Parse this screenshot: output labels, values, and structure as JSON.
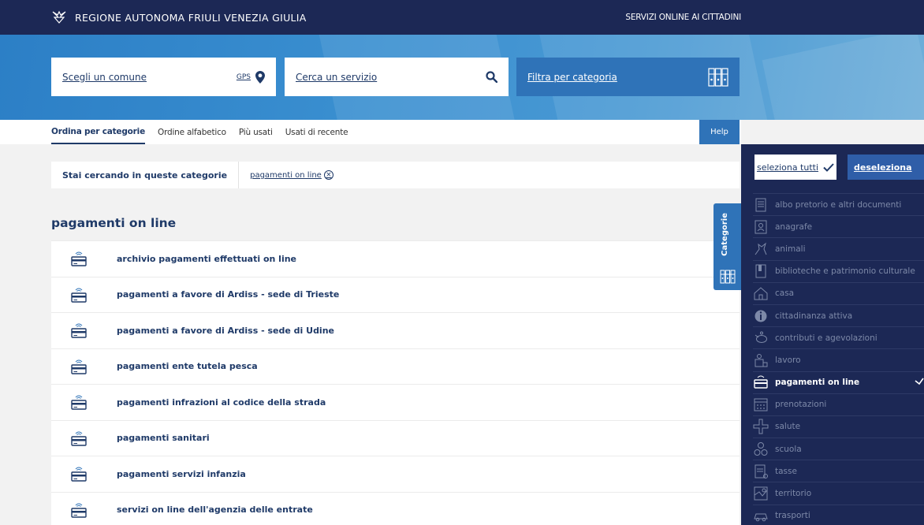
{
  "header": {
    "title": "REGIONE AUTONOMA FRIULI VENEZIA GIULIA",
    "right_link": "SERVIZI ONLINE AI CITTADINI"
  },
  "search": {
    "comune_label": "Scegli un comune",
    "gps_label": "GPS",
    "servizio_label": "Cerca un servizio",
    "filter_label": "Filtra per categoria"
  },
  "tabs": [
    {
      "label": "Ordina per categorie",
      "active": true
    },
    {
      "label": "Ordine alfabetico",
      "active": false
    },
    {
      "label": "Più usati",
      "active": false
    },
    {
      "label": "Usati di recente",
      "active": false
    }
  ],
  "help_label": "Help",
  "filter_bar": {
    "label": "Stai cercando in queste categorie",
    "chip": "pagamenti on line"
  },
  "section_title": "pagamenti on line",
  "services": [
    "archivio pagamenti effettuati on line",
    "pagamenti a favore di Ardiss - sede di Trieste",
    "pagamenti a favore di Ardiss - sede di Udine",
    "pagamenti ente tutela pesca",
    "pagamenti infrazioni al codice della strada",
    "pagamenti sanitari",
    "pagamenti servizi infanzia",
    "servizi on line dell'agenzia delle entrate"
  ],
  "categorie_tab": "Categorie",
  "panel": {
    "select_all": "seleziona tutti",
    "deselect": "deseleziona",
    "categories": [
      {
        "label": "albo pretorio e altri documenti",
        "icon": "document-list-icon",
        "selected": false
      },
      {
        "label": "anagrafe",
        "icon": "id-card-icon",
        "selected": false
      },
      {
        "label": "animali",
        "icon": "animal-icon",
        "selected": false
      },
      {
        "label": "biblioteche e patrimonio culturale",
        "icon": "book-icon",
        "selected": false
      },
      {
        "label": "casa",
        "icon": "house-icon",
        "selected": false
      },
      {
        "label": "cittadinanza attiva",
        "icon": "info-icon",
        "selected": false
      },
      {
        "label": "contributi e agevolazioni",
        "icon": "piggy-bank-icon",
        "selected": false
      },
      {
        "label": "lavoro",
        "icon": "work-icon",
        "selected": false
      },
      {
        "label": "pagamenti on line",
        "icon": "payment-card-icon",
        "selected": true
      },
      {
        "label": "prenotazioni",
        "icon": "calendar-icon",
        "selected": false
      },
      {
        "label": "salute",
        "icon": "cross-icon",
        "selected": false
      },
      {
        "label": "scuola",
        "icon": "numbers-icon",
        "selected": false
      },
      {
        "label": "tasse",
        "icon": "tax-document-icon",
        "selected": false
      },
      {
        "label": "territorio",
        "icon": "map-icon",
        "selected": false
      },
      {
        "label": "trasporti",
        "icon": "car-icon",
        "selected": false
      }
    ]
  }
}
